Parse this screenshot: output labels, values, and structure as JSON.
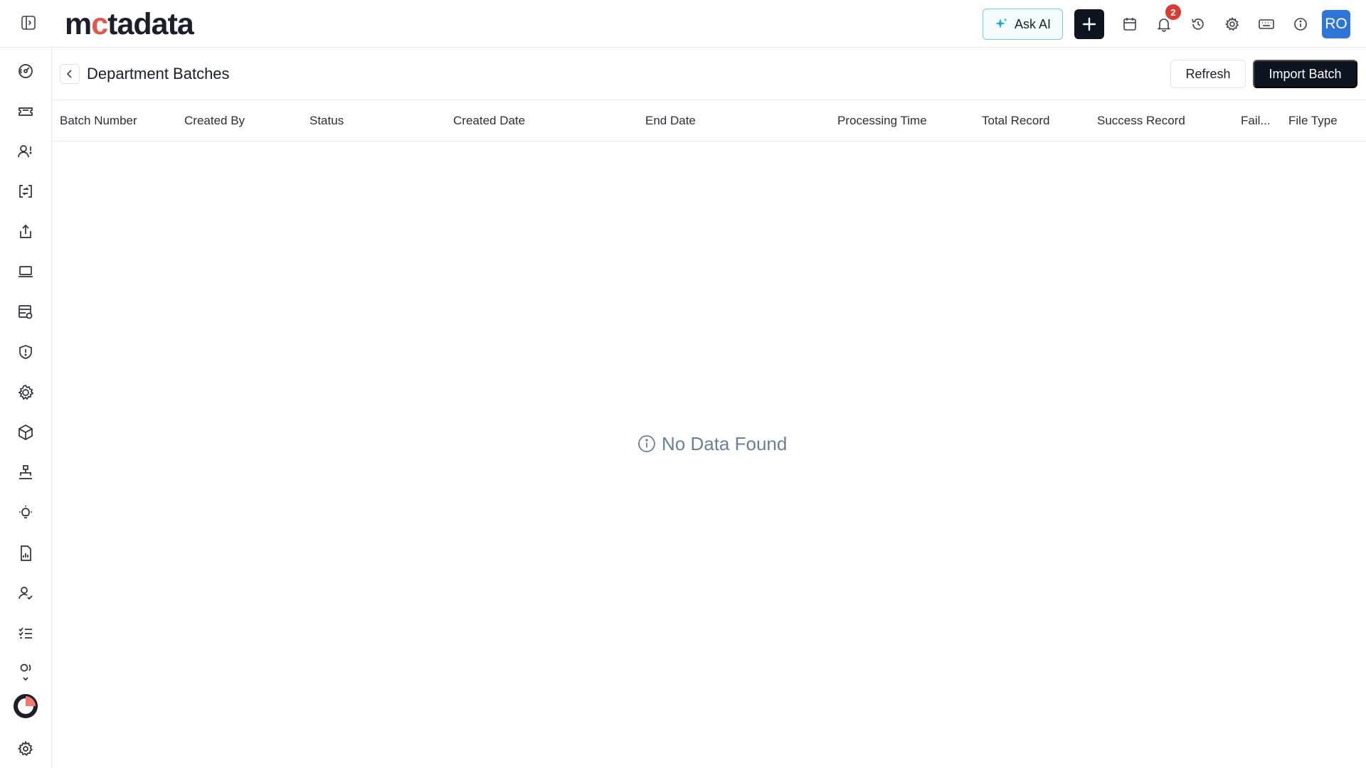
{
  "app": {
    "logo_text_1": "m",
    "logo_text_2": "c",
    "logo_text_3": "tadata"
  },
  "topbar": {
    "ask_ai_label": "Ask AI",
    "notification_count": "2",
    "avatar_initials": "RO",
    "icons": [
      "plus-icon",
      "calendar-icon",
      "bell-icon",
      "history-icon",
      "gear-icon",
      "keyboard-icon",
      "info-icon"
    ]
  },
  "sidebar": {
    "icons": [
      "dashboard-icon",
      "ticket-icon",
      "users-icon",
      "change-icon",
      "release-icon",
      "asset-icon",
      "cmdb-icon",
      "security-icon",
      "patch-icon",
      "package-icon",
      "hierarchy-icon",
      "idea-icon",
      "report-icon",
      "user-check-icon",
      "task-list-icon",
      "more-icon",
      "brand-ring-icon",
      "settings-icon"
    ]
  },
  "page": {
    "title": "Department Batches",
    "refresh_label": "Refresh",
    "import_label": "Import Batch",
    "empty_message": "No Data Found"
  },
  "table": {
    "columns": [
      "Batch Number",
      "Created By",
      "Status",
      "Created Date",
      "End Date",
      "Processing Time",
      "Total Record",
      "Success Record",
      "Fail...",
      "File Type"
    ],
    "rows": []
  },
  "colors": {
    "primary_dark": "#0e1420",
    "accent_teal": "#6fd0de",
    "badge_red": "#d93b30",
    "avatar_blue": "#2f75d6",
    "logo_accent": "#e2574c",
    "empty_text": "#6b7f96"
  }
}
